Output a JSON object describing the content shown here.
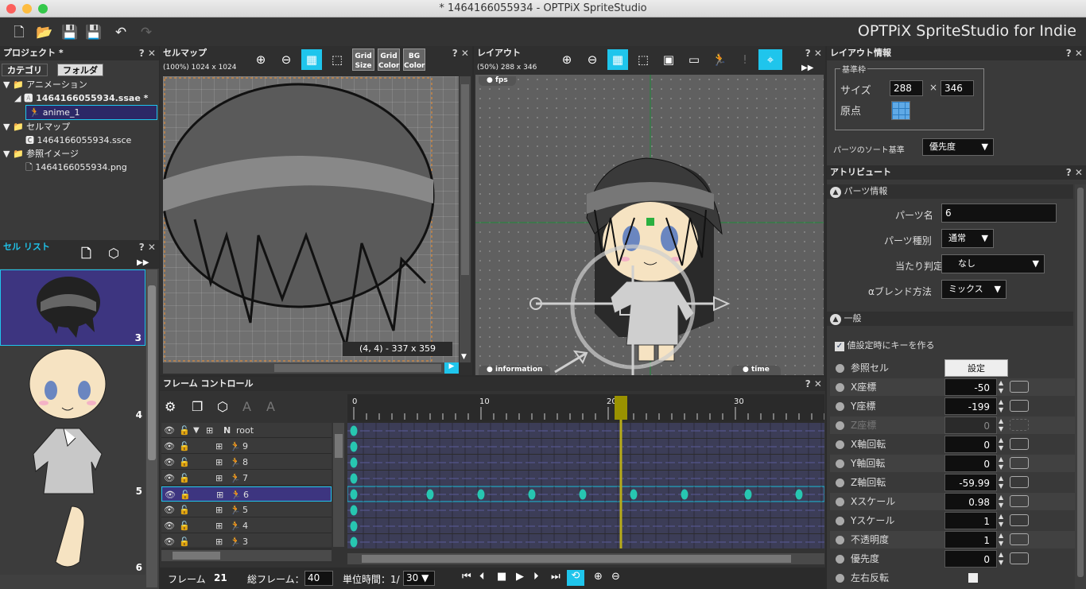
{
  "window": {
    "title": "* 1464166055934 - OPTPiX SpriteStudio",
    "brand": "OPTPiX SpriteStudio for Indie"
  },
  "colors": {
    "accent": "#1fc5ec",
    "key": "#27c6b1",
    "timeline_row": "#3c3d57",
    "selection": "#3d3580"
  },
  "project": {
    "title": "プロジェクト *",
    "tabs": [
      "カテゴリ",
      "フォルダ"
    ],
    "tree": [
      {
        "label": "アニメーション",
        "level": 0
      },
      {
        "label": "1464166055934.ssae *",
        "level": 1
      },
      {
        "label": "anime_1",
        "level": 2
      },
      {
        "label": "セルマップ",
        "level": 0
      },
      {
        "label": "1464166055934.ssce",
        "level": 1
      },
      {
        "label": "参照イメージ",
        "level": 0
      },
      {
        "label": "1464166055934.png",
        "level": 1
      }
    ]
  },
  "cell_list": {
    "title": "セル リスト",
    "items": [
      "3",
      "4",
      "5",
      "6"
    ]
  },
  "cellmap": {
    "title": "セルマップ",
    "info": "(100%) 1024 x 1024",
    "grid_buttons": [
      {
        "line1": "Grid",
        "line2": "Size"
      },
      {
        "line1": "Grid",
        "line2": "Color"
      },
      {
        "line1": "BG",
        "line2": "Color"
      }
    ],
    "coord_readout": "(4, 4) - 337 x 359"
  },
  "layout": {
    "title": "レイアウト",
    "info": "(50%) 288 x 346",
    "tags": {
      "fps": "fps",
      "information": "information",
      "time": "time"
    }
  },
  "layout_info": {
    "title": "レイアウト情報",
    "group": "基準枠",
    "size_label": "サイズ",
    "width": "288",
    "times": "×",
    "height": "346",
    "origin_label": "原点",
    "sort_label": "パーツのソート基準",
    "sort_value": "優先度"
  },
  "attributes": {
    "title": "アトリビュート",
    "parts_section": "パーツ情報",
    "parts_name_label": "パーツ名",
    "parts_name": "6",
    "parts_type_label": "パーツ種別",
    "parts_type": "通常",
    "hit_label": "当たり判定",
    "hit_value": "なし",
    "blend_label": "αブレンド方法",
    "blend_value": "ミックス",
    "general_section": "一般",
    "key_on_set": "値設定時にキーを作る",
    "ref_cell_label": "参照セル",
    "ref_cell_button": "設定",
    "rows": [
      {
        "label": "X座標",
        "value": "-50",
        "dim": false
      },
      {
        "label": "Y座標",
        "value": "-199",
        "dim": false
      },
      {
        "label": "Z座標",
        "value": "0",
        "dim": true
      },
      {
        "label": "X軸回転",
        "value": "0",
        "dim": false
      },
      {
        "label": "Y軸回転",
        "value": "0",
        "dim": false
      },
      {
        "label": "Z軸回転",
        "value": "-59.99",
        "dim": false
      },
      {
        "label": "Xスケール",
        "value": "0.98",
        "dim": false
      },
      {
        "label": "Yスケール",
        "value": "1",
        "dim": false
      },
      {
        "label": "不透明度",
        "value": "1",
        "dim": false
      },
      {
        "label": "優先度",
        "value": "0",
        "dim": false
      }
    ],
    "flip_label": "左右反転"
  },
  "frame_control": {
    "title": "フレーム コントロール",
    "ruler": [
      "0",
      "10",
      "20",
      "30"
    ],
    "current_frame": 21,
    "tracks": [
      {
        "name": "root",
        "prefix": "N",
        "keys": [
          0
        ]
      },
      {
        "name": "9",
        "keys": [
          0
        ]
      },
      {
        "name": "8",
        "keys": [
          0
        ]
      },
      {
        "name": "7",
        "keys": [
          0
        ]
      },
      {
        "name": "6",
        "keys": [
          0,
          6,
          10,
          14,
          18,
          22,
          26,
          31,
          35
        ],
        "selected": true
      },
      {
        "name": "5",
        "keys": [
          0
        ]
      },
      {
        "name": "4",
        "keys": [
          0
        ]
      },
      {
        "name": "3",
        "keys": [
          0
        ]
      }
    ],
    "frame_label": "フレーム",
    "frame_value": "21",
    "total_label": "総フレーム：",
    "total_value": "40",
    "unit_label": "単位時間：1/",
    "unit_value": "30"
  }
}
